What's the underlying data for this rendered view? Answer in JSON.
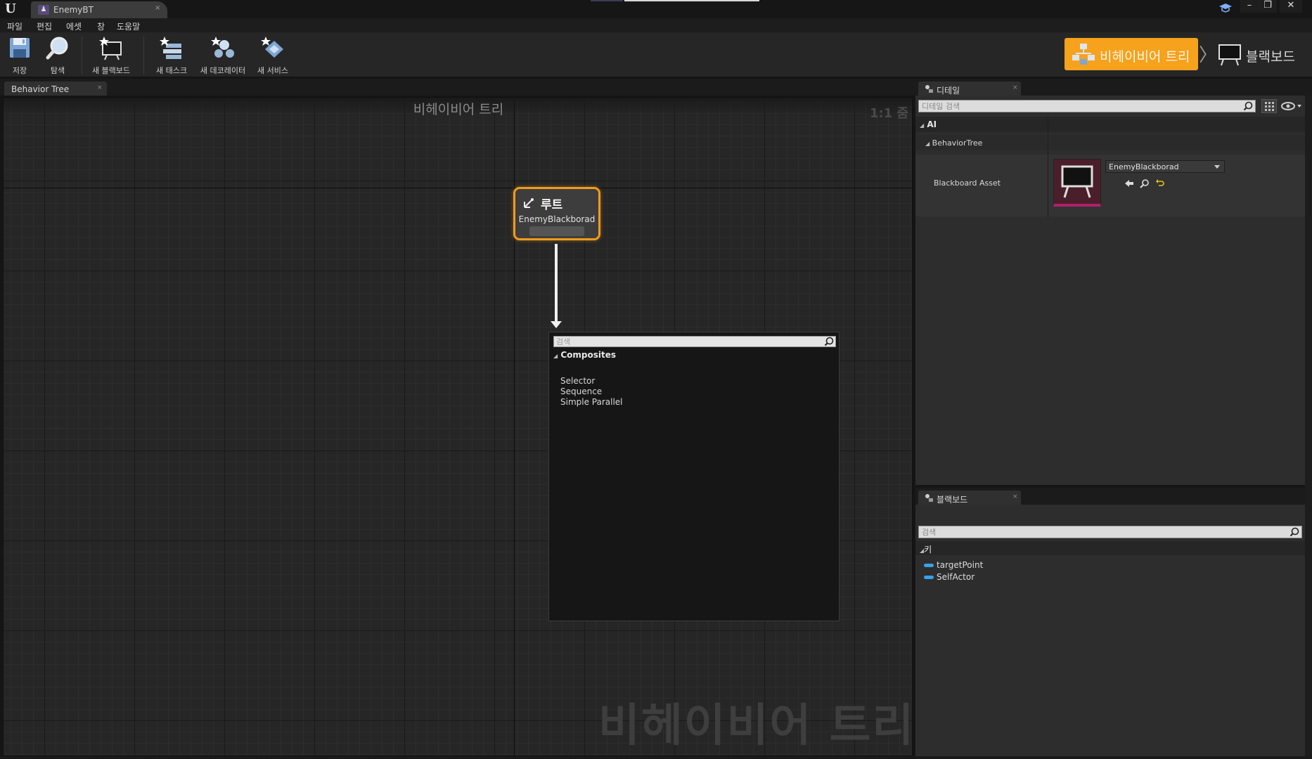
{
  "titlebar": {
    "tab_label": "EnemyBT",
    "tab_close": "×",
    "logo": "U",
    "win_minimize": "–",
    "win_restore": "❐",
    "win_close": "✕"
  },
  "menu": {
    "items": [
      "파일",
      "편집",
      "에셋",
      "창",
      "도움말"
    ]
  },
  "toolbar": {
    "save_label": "저장",
    "browse_label": "탐색",
    "new_blackboard_label": "새 블랙보드",
    "new_task_label": "새 태스크",
    "new_decorator_label": "새 데코레이터",
    "new_service_label": "새 서비스"
  },
  "modes": {
    "behavior_tree_label": "비헤이비어 트리",
    "separator": "〉",
    "blackboard_label": "블랙보드"
  },
  "graph": {
    "tab_label": "Behavior Tree",
    "tab_close": "×",
    "title": "비헤이비어 트리",
    "zoom": "1:1 줌",
    "watermark": "비헤이비어 트리",
    "root_node": {
      "title": "루트",
      "subtitle": "EnemyBlackborad"
    }
  },
  "context_menu": {
    "search_placeholder": "검색",
    "category": "Composites",
    "items": [
      "Selector",
      "Sequence",
      "Simple Parallel"
    ]
  },
  "details": {
    "tab_label": "디테일",
    "tab_close": "×",
    "search_placeholder": "디테일 검색",
    "category_ai": "AI",
    "category_behavior_tree": "BehaviorTree",
    "property_name": "Blackboard Asset",
    "asset_value": "EnemyBlackborad"
  },
  "blackboard": {
    "tab_label": "블랙보드",
    "tab_close": "×",
    "search_placeholder": "검색",
    "category": "키",
    "keys": [
      "targetPoint",
      "SelfActor"
    ],
    "key_color": "#3aa0e8"
  },
  "colors": {
    "accent": "#f6a21d",
    "root_border": "#f29b1c"
  }
}
